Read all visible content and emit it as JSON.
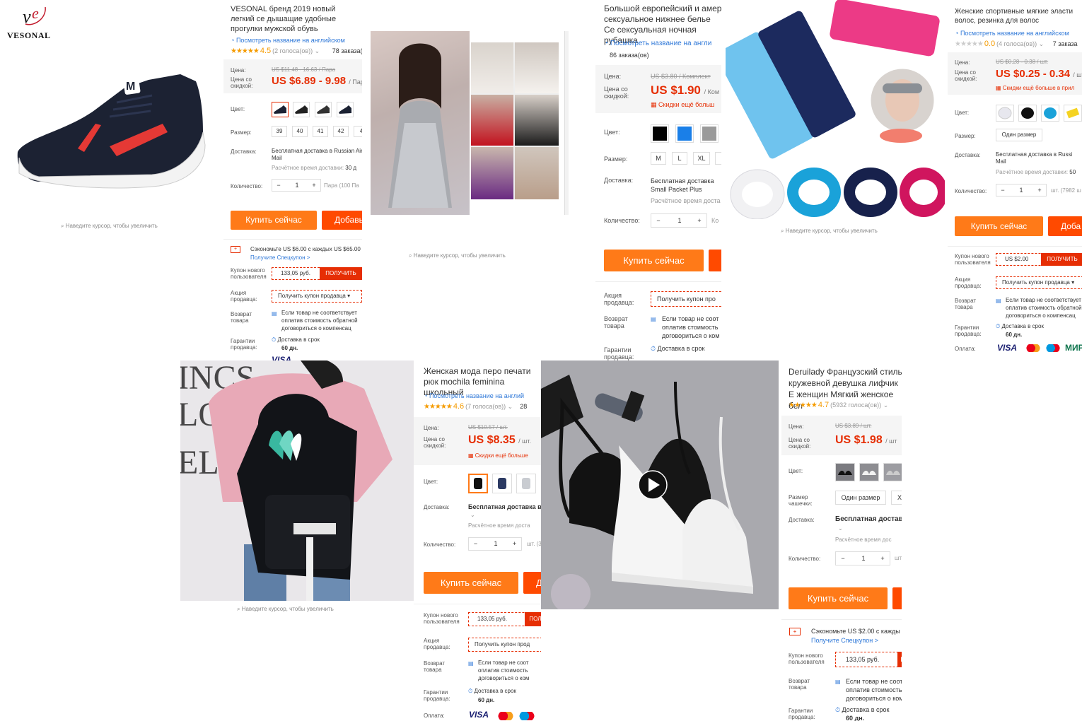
{
  "common": {
    "hover_hint": "Наведите курсор, чтобы увеличить",
    "english_link": "Посмотреть название на английском",
    "english_link_short": "Посмотреть название на англи",
    "english_link_cut": "Посмотреть название на англий",
    "label_price": "Цена:",
    "label_discount_price": "Цена со скидкой:",
    "label_color": "Цвет:",
    "label_size": "Размер:",
    "label_cup_size": "Размер чашечки:",
    "label_delivery": "Доставка:",
    "label_quantity": "Количество:",
    "label_new_user_coupon": "Купон нового пользователя",
    "label_seller_promo": "Акция продавца:",
    "label_return": "Возврат товара",
    "label_guarantee": "Гарантии продавца:",
    "label_payment": "Оплата:",
    "buy_now": "Купить сейчас",
    "add_to_cart_short": "Добавь",
    "add_to_cart_cut": "Доба",
    "get_coupon": "ПОЛУЧИТЬ",
    "get_short": "ПОЛ",
    "get_cut": "ПО",
    "coupon_amount": "133,05 руб.",
    "seller_coupon": "Получить купон продавца",
    "seller_coupon_cut": "Получить купон прод",
    "seller_coupon_short": "Получить купон про",
    "return_text": "Если товар не соответствует оплатив стоимость обратной договориться о компенсац",
    "return_text_cut": "Если товар не соот оплатив стоимость договориться о ком",
    "delivery_on_time": "Доставка в срок",
    "days": "60 дн.",
    "free_delivery_russian_air": "Бесплатная доставка в Russian Air Mail",
    "delivery_est": "Расчётное время доставки:",
    "save_text": "Сэкономьте US $6.00 с каждых US $65.00",
    "save_text2": "Сэкономьте US $2.00 с кажды",
    "special_coupon": "Получите Спецкупон >",
    "more_discounts": "Скидки ещё больше в прил",
    "more_discounts_short": "Скидки ещё больше",
    "qty_minus": "−",
    "qty_plus": "+",
    "qty_value": "1",
    "visa": "VISA",
    "mir": "МИР",
    "star_glyphs": "★★★★★"
  },
  "logo": {
    "text": "VESONAL",
    "monogram": "ve"
  },
  "p1": {
    "title": "VESONAL бренд 2019 новый легкий се дышащие удобные прогулки мужской обувь",
    "rating": "4.5",
    "votes": "(2 голоса(ов))",
    "orders": "78 заказа(о",
    "old_price": "US $11.48 - 16.63 / Пара",
    "new_price": "US $6.89 - 9.98",
    "unit": "/ Пар",
    "sizes": [
      "39",
      "40",
      "41",
      "42",
      "4"
    ],
    "delivery": "Бесплатная доставка в Russian Air Mail",
    "delivery_time": "30 д",
    "qty_unit": "Пара (100 Па"
  },
  "p2": {
    "title": "Большой европейский и амер сексуальное нижнее белье Се сексуальная ночная рубашка",
    "orders": "86 заказа(ов)",
    "old_price": "US $3.80 / Комплект",
    "new_price": "US $1.90",
    "unit": "/ Ком",
    "promo": "Скидки ещё больш",
    "colors": [
      "#000000",
      "#1a7fe8",
      "#9a9a9a"
    ],
    "sizes": [
      "M",
      "L",
      "XL",
      ""
    ],
    "delivery": "Бесплатная доставка Small Packet Plus",
    "delivery_time": "Расчётное время доста",
    "qty_unit": "Ко"
  },
  "p3": {
    "title": "Женские спортивные мягкие эласти волос, резинка для волос",
    "rating": "0.0",
    "votes": "(4 голоса(ов))",
    "orders": "7 заказа",
    "old_price": "US $0.28 - 0.38 / шт.",
    "new_price": "US $0.25 - 0.34",
    "unit": "/ шт.",
    "size": "Один размер",
    "delivery": "Бесплатная доставка в Russi Mail",
    "delivery_time": "50",
    "qty_unit": "шт. (7982 ш",
    "coupon": "US $2.00",
    "seller_coupon": "Получить купон продавца"
  },
  "p4": {
    "title": "Женская мода перо печати рюк mochila feminina школьный",
    "rating": "4.6",
    "votes": "(7 голоса(ов))",
    "orders": "28",
    "old_price": "US $10.57 / шт.",
    "new_price": "US $8.35",
    "unit": "/ шт.",
    "promo": "Скидки ещё больше",
    "delivery": "Бесплатная доставка в",
    "delivery_time": "Расчётное время доста",
    "qty_unit": "шт. (3",
    "add_letter": "Д",
    "feather_colors": [
      "#39b8a0",
      "#6fd6c3",
      "#ffffff"
    ]
  },
  "p5": {
    "title": "Deruilady Французский стиль кружевной девушка лифчик Е женщин Мягкий женское бел",
    "rating": "4.7",
    "votes": "(5932 голоса(ов))",
    "old_price": "US $3.89 / шт.",
    "new_price": "US $1.98",
    "unit": "/ шт",
    "size": "Один размер",
    "size2": "X",
    "delivery": "Бесплатная доставк",
    "delivery_time": "Расчётное время дос",
    "qty_unit": "шт"
  }
}
